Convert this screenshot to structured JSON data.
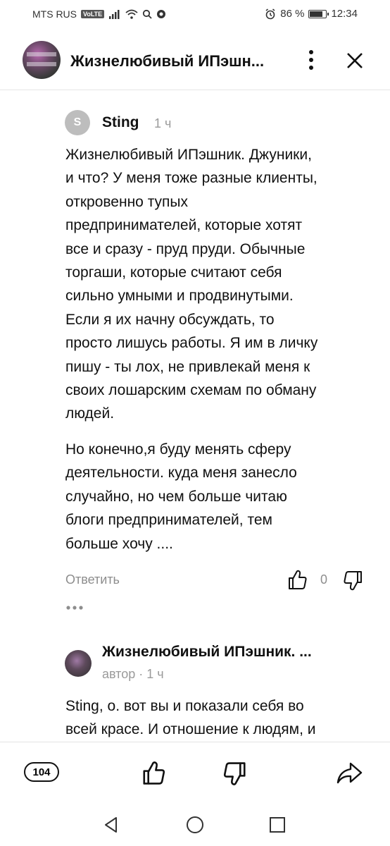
{
  "status_bar": {
    "carrier": "MTS RUS",
    "volte": "VoLTE",
    "battery_text": "86 %",
    "battery_level": 0.86,
    "time": "12:34"
  },
  "header": {
    "title": "Жизнелюбивый ИПэшн..."
  },
  "comment": {
    "avatar_letter": "S",
    "author": "Sting",
    "time": "1 ч",
    "paragraph1": [
      "Жизнелюбивый ИПэшник. Джуники,",
      "и что? У меня тоже разные клиенты,",
      "откровенно тупых",
      "предпринимателей, которые хотят",
      "все и сразу - пруд пруди. Обычные",
      "торгаши, которые считают себя",
      "сильно умными и продвинутыми.",
      "Если я их начну обсуждать, то",
      "просто лишусь работы. Я им в личку",
      "пишу - ты лох, не привлекай меня к",
      "своих лошарским схемам по обману",
      "людей."
    ],
    "paragraph2": [
      "Но конечно,я буду менять сферу",
      "деятельности. куда меня занесло",
      "случайно, но чем больше читаю",
      "блоги предпринимателей, тем",
      "больше хочу ...."
    ],
    "reply_label": "Ответить",
    "like_count": "0"
  },
  "reply": {
    "author": "Жизнелюбивый ИПэшник. ...",
    "meta": "автор · 1 ч",
    "paragraph": [
      "Sting, о. вот вы и показали себя во",
      "всей красе. И отношение к людям, и"
    ]
  },
  "bottom_bar": {
    "comments_count": "104"
  },
  "icons": [
    "signal-icon",
    "wifi-icon",
    "search-icon",
    "alarm-icon",
    "battery-icon",
    "more-vert-icon",
    "close-icon",
    "thumb-up-icon",
    "thumb-down-icon",
    "share-icon",
    "nav-back-icon",
    "nav-home-icon",
    "nav-recent-icon"
  ]
}
